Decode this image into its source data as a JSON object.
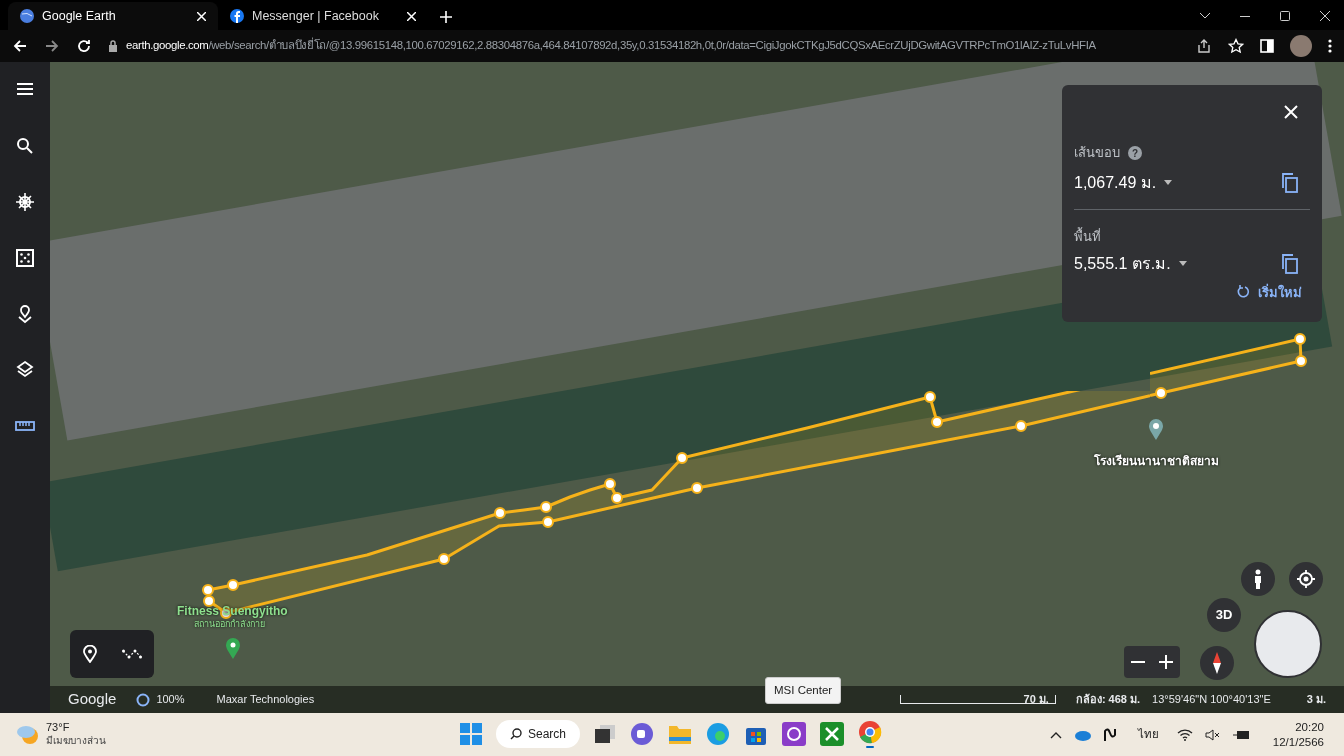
{
  "browser": {
    "tabs": [
      {
        "title": "Google Earth",
        "selected": true,
        "kind": "earth"
      },
      {
        "title": "Messenger | Facebook",
        "selected": false,
        "kind": "facebook"
      }
    ],
    "url": {
      "host": "earth.google.com",
      "path": "/web/search/ตำบลบึงยี่โถ/@13.99615148,100.67029162,2.88304876a,464.84107892d,35y,0.31534182h,0t,0r/data=CigiJgokCTKgJ5dCQSxAEcrZUjDGwitAGVTRPcTmO1lAIZ-zTuLvHFIA"
    }
  },
  "sidebar": {
    "items": [
      {
        "kind": "menu",
        "selected": false
      },
      {
        "kind": "search",
        "selected": false
      },
      {
        "kind": "voyager",
        "selected": false
      },
      {
        "kind": "dice",
        "selected": false
      },
      {
        "kind": "projects",
        "selected": false
      },
      {
        "kind": "layers",
        "selected": false
      },
      {
        "kind": "ruler",
        "selected": true
      }
    ]
  },
  "measure_panel": {
    "perimeter_label": "เส้นขอบ",
    "help_glyph": "?",
    "perimeter_value": "1,067.49 ม.",
    "area_label": "พื้นที่",
    "area_value": "5,555.1 ตร.ม.",
    "reset_label": "เริ่มใหม่"
  },
  "map_labels": [
    {
      "text": "โรงเรียนนานาชาติสยาม",
      "kind": "school"
    },
    {
      "text": "Fitness Suengyitho",
      "kind": "place"
    },
    {
      "text": "สถานออกกำลังกาย",
      "kind": "sub"
    }
  ],
  "zoom_controls": {
    "view_3d": "3D"
  },
  "status_bar": {
    "logo": "Google",
    "load": "100%",
    "attribution": "Maxar Technologies",
    "scale": "70 ม.",
    "camera": "กล้อง: 468 ม.",
    "coordinates": "13°59'46\"N 100°40'13\"E",
    "elevation": "3 ม."
  },
  "tooltip": "MSI Center",
  "taskbar": {
    "temperature": "73°F",
    "weather": "มีเมฆบางส่วน",
    "search": "Search",
    "language": "ไทย",
    "time": "20:20",
    "date": "12/1/2566"
  }
}
